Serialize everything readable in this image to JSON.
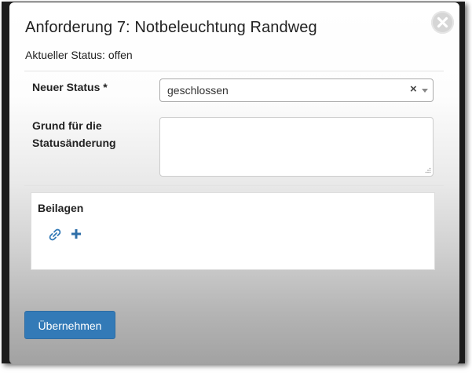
{
  "dialog": {
    "title": "Anforderung 7: Notbeleuchtung Randweg",
    "status_text": "Aktueller Status: offen",
    "close_icon": "close-x-icon"
  },
  "form": {
    "status_label": "Neuer Status *",
    "status_value": "geschlossen",
    "clear_icon": "clear-x-icon",
    "reason_label_line1": "Grund für die",
    "reason_label_line2": "Statusänderung",
    "reason_value": ""
  },
  "attachments": {
    "title": "Beilagen",
    "link_icon": "link-icon",
    "add_icon": "plus-icon"
  },
  "actions": {
    "submit_label": "Übernehmen"
  },
  "colors": {
    "primary": "#337ab7",
    "icon_blue": "#337ab7",
    "frame": "#1c1c1c"
  }
}
